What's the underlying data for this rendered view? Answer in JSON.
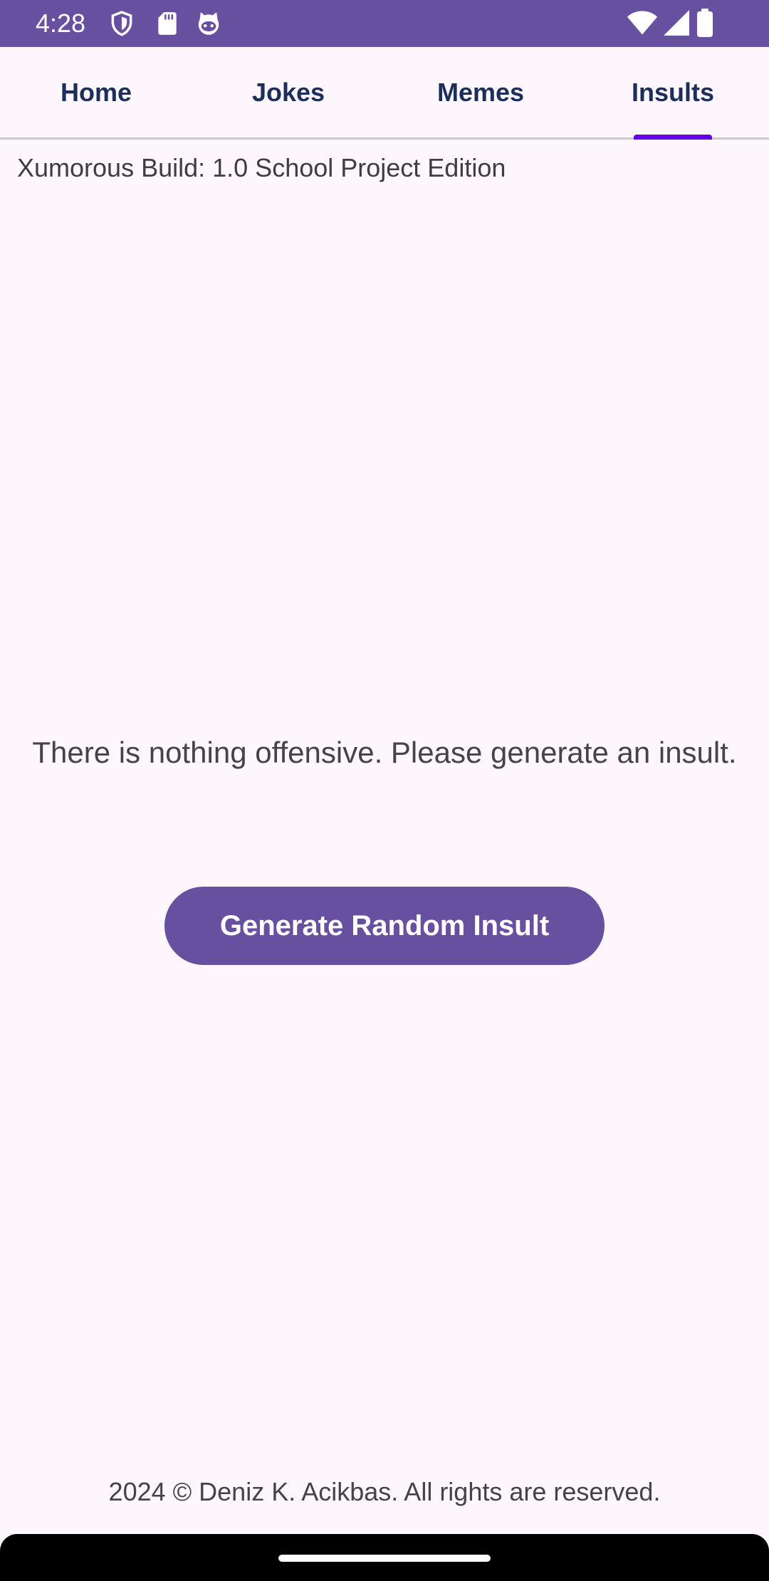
{
  "status_bar": {
    "time": "4:28",
    "left_icons": [
      "shield-icon",
      "sd-card-icon",
      "cat-face-icon"
    ],
    "right_icons": [
      "wifi-icon",
      "cell-signal-icon",
      "battery-icon"
    ],
    "background": "#67509f"
  },
  "tabs": [
    {
      "label": "Home",
      "selected": false
    },
    {
      "label": "Jokes",
      "selected": false
    },
    {
      "label": "Memes",
      "selected": false
    },
    {
      "label": "Insults",
      "selected": true
    }
  ],
  "build_info": "Xumorous Build: 1.0 School Project Edition",
  "insult": {
    "message": "There is nothing offensive. Please generate an insult.",
    "button_label": "Generate Random Insult"
  },
  "footer": {
    "text": "2024 © Deniz K. Acikbas. All rights are reserved."
  },
  "colors": {
    "accent": "#67509f",
    "tab_indicator": "#6200ee",
    "tab_text": "#1c2f5b",
    "background": "#fdf7fd"
  }
}
